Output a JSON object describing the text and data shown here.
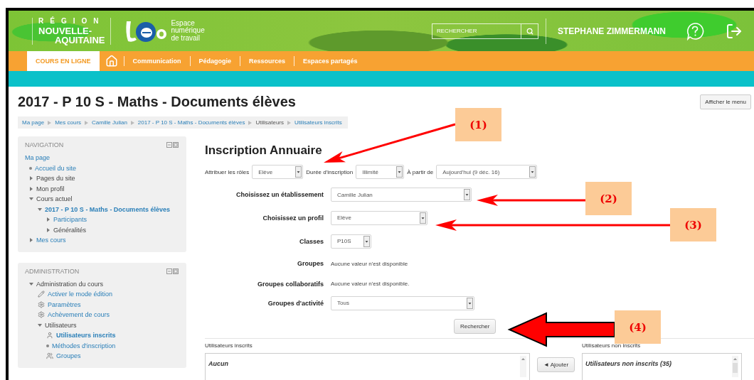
{
  "header": {
    "region_label": "RÉGION",
    "region_lines": [
      "NOUVELLE-",
      "AQUITAINE"
    ],
    "tagline_lines": [
      "Espace",
      "numérique",
      "de travail"
    ],
    "search": {
      "placeholder": "RECHERCHER"
    },
    "user_name": "STEPHANE ZIMMERMANN"
  },
  "nav": {
    "items": [
      {
        "kind": "tab",
        "label": "COURS EN LIGNE",
        "selected": true
      },
      {
        "kind": "home",
        "selected": false
      },
      {
        "kind": "tab",
        "label": "Communication",
        "selected": false
      },
      {
        "kind": "tab",
        "label": "Pédagogie",
        "selected": false
      },
      {
        "kind": "tab",
        "label": "Ressources",
        "selected": false
      },
      {
        "kind": "tab",
        "label": "Espaces partagés",
        "selected": false
      }
    ]
  },
  "page": {
    "title": "2017 - P 10 S - Maths - Documents élèves",
    "menu_button": "Afficher le menu",
    "breadcrumb": [
      {
        "label": "Ma page",
        "link": true
      },
      {
        "label": "Mes cours",
        "link": true
      },
      {
        "label": "Camille Julian",
        "link": true
      },
      {
        "label": "2017 - P 10 S - Maths - Documents élèves",
        "link": true
      },
      {
        "label": "Utilisateurs",
        "link": false
      },
      {
        "label": "Utilisateurs inscrits",
        "link": true
      }
    ]
  },
  "blocks": [
    {
      "title": "NAVIGATION",
      "items": [
        {
          "label": "Ma page",
          "kind": "plain",
          "link": true,
          "current": false
        },
        {
          "label": "Accueil du site",
          "kind": "bullet",
          "link": true,
          "current": false
        },
        {
          "label": "Pages du site",
          "kind": "branch",
          "expanded": false,
          "link": false,
          "current": false
        },
        {
          "label": "Mon profil",
          "kind": "branch",
          "expanded": false,
          "link": false,
          "current": false
        },
        {
          "label": "Cours actuel",
          "kind": "branch",
          "expanded": true,
          "link": false,
          "current": false,
          "children": [
            {
              "label": "2017 - P 10 S - Maths - Documents élèves",
              "kind": "branch",
              "expanded": true,
              "link": true,
              "current": true,
              "children": [
                {
                  "label": "Participants",
                  "kind": "branch",
                  "expanded": false,
                  "link": true,
                  "current": false
                },
                {
                  "label": "Généralités",
                  "kind": "branch",
                  "expanded": false,
                  "link": false,
                  "current": false
                }
              ]
            }
          ]
        },
        {
          "label": "Mes cours",
          "kind": "branch",
          "expanded": false,
          "link": true,
          "current": false
        }
      ]
    },
    {
      "title": "ADMINISTRATION",
      "items": [
        {
          "label": "Administration du cours",
          "kind": "branch",
          "expanded": true,
          "link": false,
          "current": false,
          "children": [
            {
              "label": "Activer le mode édition",
              "kind": "pencil",
              "link": true,
              "current": false
            },
            {
              "label": "Paramètres",
              "kind": "gear",
              "link": true,
              "current": false
            },
            {
              "label": "Achèvement de cours",
              "kind": "gear",
              "link": true,
              "current": false
            },
            {
              "label": "Utilisateurs",
              "kind": "branch",
              "expanded": true,
              "link": false,
              "current": false,
              "children": [
                {
                  "label": "Utilisateurs inscrits",
                  "kind": "user",
                  "link": true,
                  "current": true
                },
                {
                  "label": "Méthodes d'inscription",
                  "kind": "bullet",
                  "link": true,
                  "current": false
                },
                {
                  "label": "Groupes",
                  "kind": "group",
                  "link": true,
                  "current": false
                }
              ]
            }
          ]
        }
      ]
    }
  ],
  "form": {
    "title": "Inscription Annuaire",
    "top_row": [
      {
        "label": "Attribuer les rôles",
        "value": "Elève"
      },
      {
        "label": "Durée d'inscription",
        "value": "Illimité"
      },
      {
        "label": "À partir de",
        "value": "Aujourd'hui (9 déc. 16)"
      }
    ],
    "rows": [
      {
        "kind": "select",
        "label": "Choisissez un établissement",
        "value": "Camille Julian"
      },
      {
        "kind": "select",
        "label": "Choisissez un profil",
        "value": "Elève"
      },
      {
        "kind": "select",
        "label": "Classes",
        "value": "P10S"
      },
      {
        "kind": "text",
        "label": "Groupes",
        "value": "Aucune valeur n'est disponible"
      },
      {
        "kind": "text",
        "label": "Groupes collaboratifs",
        "value": "Aucune valeur n'est disponible."
      },
      {
        "kind": "select",
        "label": "Groupes d'activité",
        "value": "Tous"
      }
    ],
    "search_button": "Rechercher"
  },
  "users": {
    "enrolled": {
      "title": "Utilisateurs inscrits",
      "options": [
        "Aucun"
      ]
    },
    "add_button": "◄ Ajouter",
    "not_enrolled": {
      "title": "Utilisateurs non inscrits",
      "options": [
        "Utilisateurs non inscrits (35)"
      ]
    }
  },
  "annotations": [
    {
      "label": "(1)",
      "kind": "line"
    },
    {
      "label": "(2)",
      "kind": "line"
    },
    {
      "label": "(3)",
      "kind": "line"
    },
    {
      "label": "(4)",
      "kind": "block"
    }
  ]
}
